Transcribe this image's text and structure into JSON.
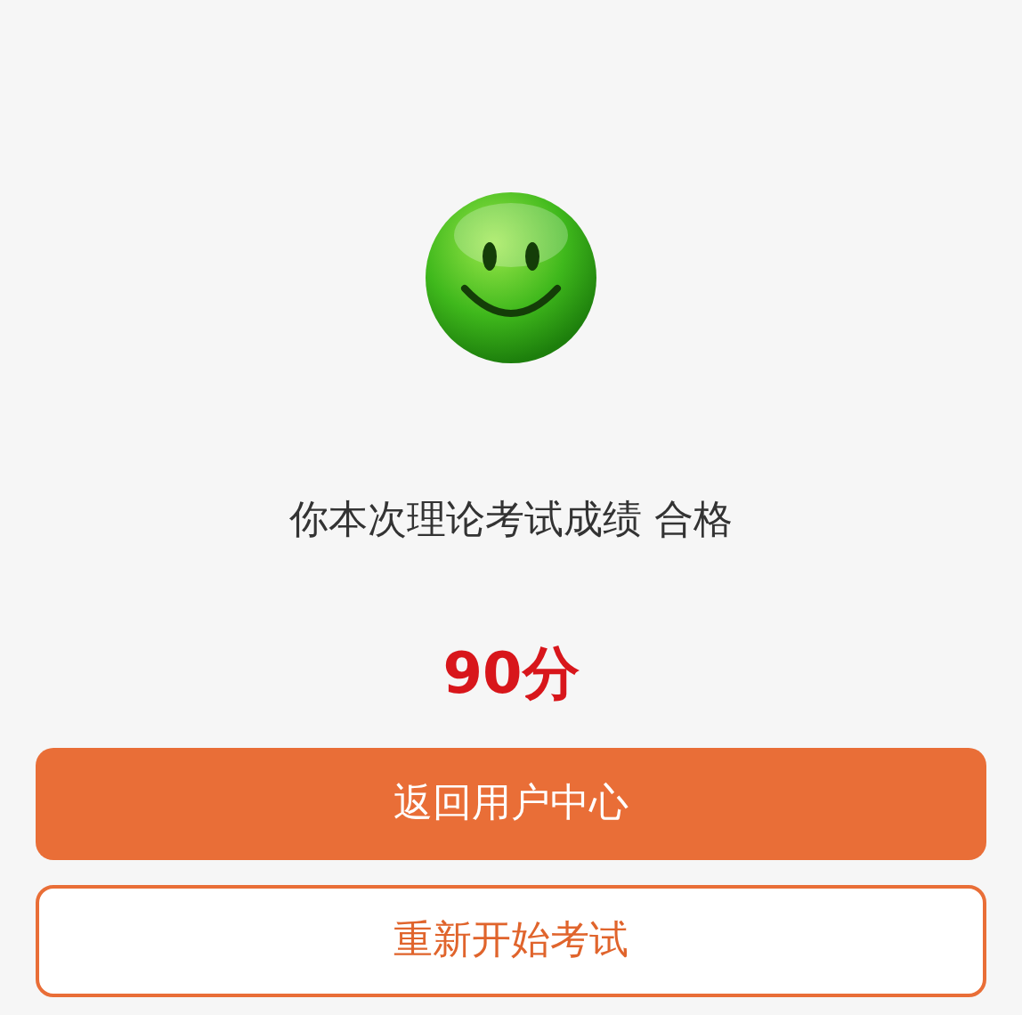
{
  "result_message": "你本次理论考试成绩 合格",
  "score": "90分",
  "buttons": [
    {
      "label": "返回用户中心",
      "kind": "primary"
    },
    {
      "label": "重新开始考试",
      "kind": "outline"
    }
  ]
}
